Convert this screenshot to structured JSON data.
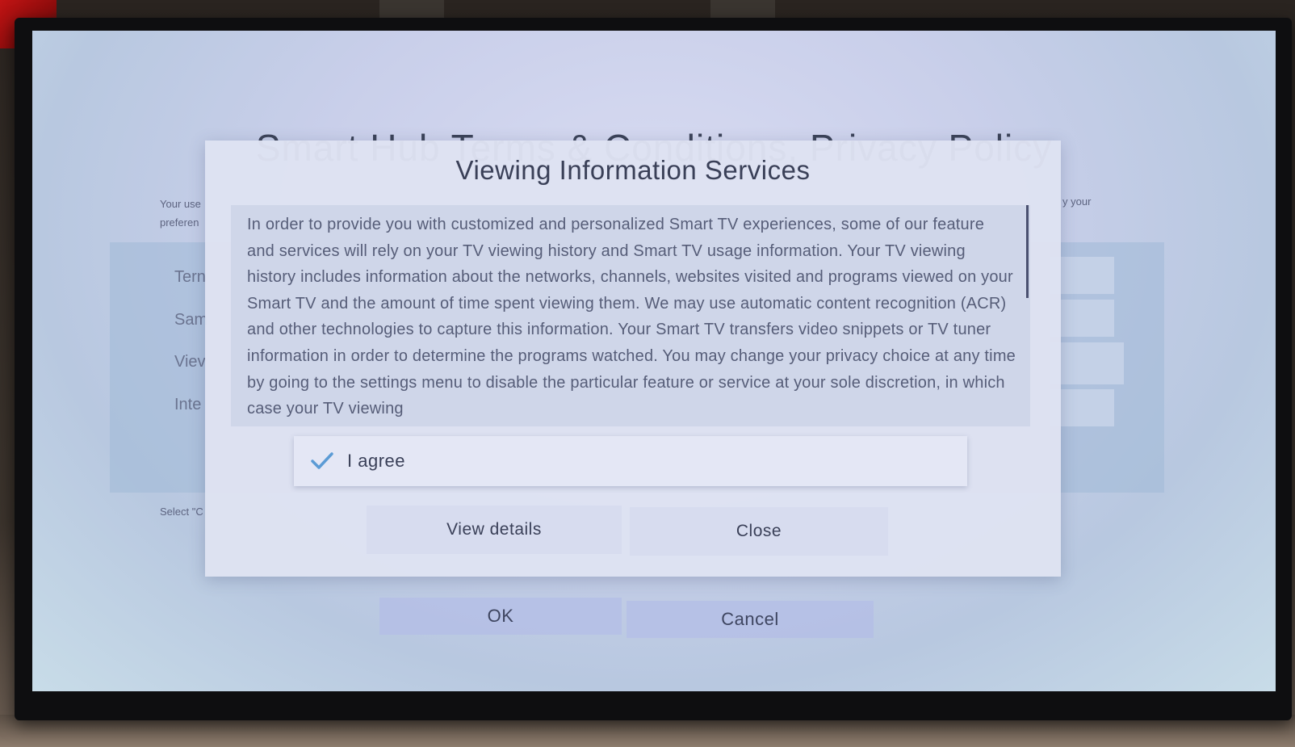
{
  "background_page": {
    "title": "Smart Hub Terms & Conditions, Privacy Policy",
    "note_left_line1": "Your use",
    "note_left_line2": "preferen",
    "note_right": "y your",
    "items": [
      "Tern",
      "Sam",
      "Viev",
      "Inte"
    ],
    "select_hint": "Select \"C",
    "ok_label": "OK",
    "cancel_label": "Cancel"
  },
  "dialog": {
    "title": "Viewing Information Services",
    "body_text": "In order to provide you with customized and personalized Smart TV experiences, some of our feature and services will rely on your TV viewing history and Smart TV usage information. Your TV viewing history includes information about the networks, channels, websites visited and programs viewed on your Smart TV and the amount of time spent viewing them. We may use automatic content recognition (ACR) and other technologies to capture this information. Your Smart TV transfers video snippets or TV tuner information in order to determine the programs watched. You may change your privacy choice at any time by going to the settings menu to disable the particular feature or service at your sole discretion, in which case your TV viewing",
    "agree_label": "I agree",
    "agree_checked": true,
    "view_details_label": "View details",
    "close_label": "Close"
  },
  "colors": {
    "check": "#5b9bd5",
    "dialog_bg": "#dee2f2",
    "text": "#3a4058"
  }
}
